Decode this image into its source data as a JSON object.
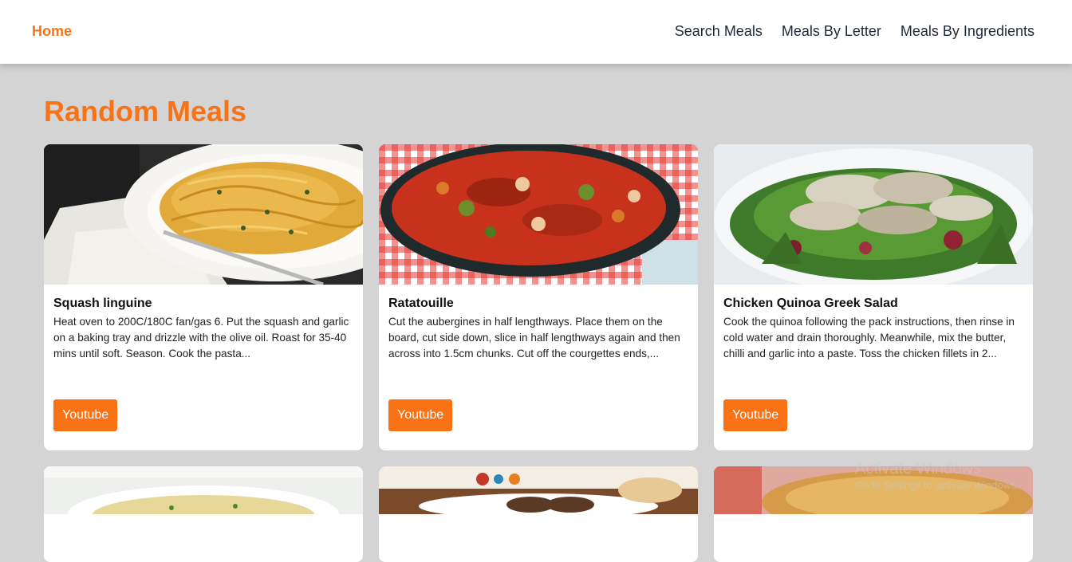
{
  "nav": {
    "home": "Home",
    "links": [
      "Search Meals",
      "Meals By Letter",
      "Meals By Ingredients"
    ]
  },
  "page": {
    "title": "Random Meals"
  },
  "meals": [
    {
      "name": "Squash linguine",
      "description": "Heat oven to 200C/180C fan/gas 6. Put the squash and garlic on a baking tray and drizzle with the olive oil. Roast for 35-40 mins until soft. Season. Cook the pasta...",
      "button": "Youtube"
    },
    {
      "name": "Ratatouille",
      "description": "Cut the aubergines in half lengthways. Place them on the board, cut side down, slice in half lengthways again and then across into 1.5cm chunks. Cut off the courgettes ends,...",
      "button": "Youtube"
    },
    {
      "name": "Chicken Quinoa Greek Salad",
      "description": "Cook the quinoa following the pack instructions, then rinse in cold water and drain thoroughly. Meanwhile, mix the butter, chilli and garlic into a paste. Toss the chicken fillets in 2...",
      "button": "Youtube"
    }
  ],
  "watermark": {
    "line1": "Activate Windows",
    "line2": "Go to Settings to activate Windows."
  },
  "colors": {
    "accent": "#f97316",
    "background": "#d4d4d4"
  }
}
